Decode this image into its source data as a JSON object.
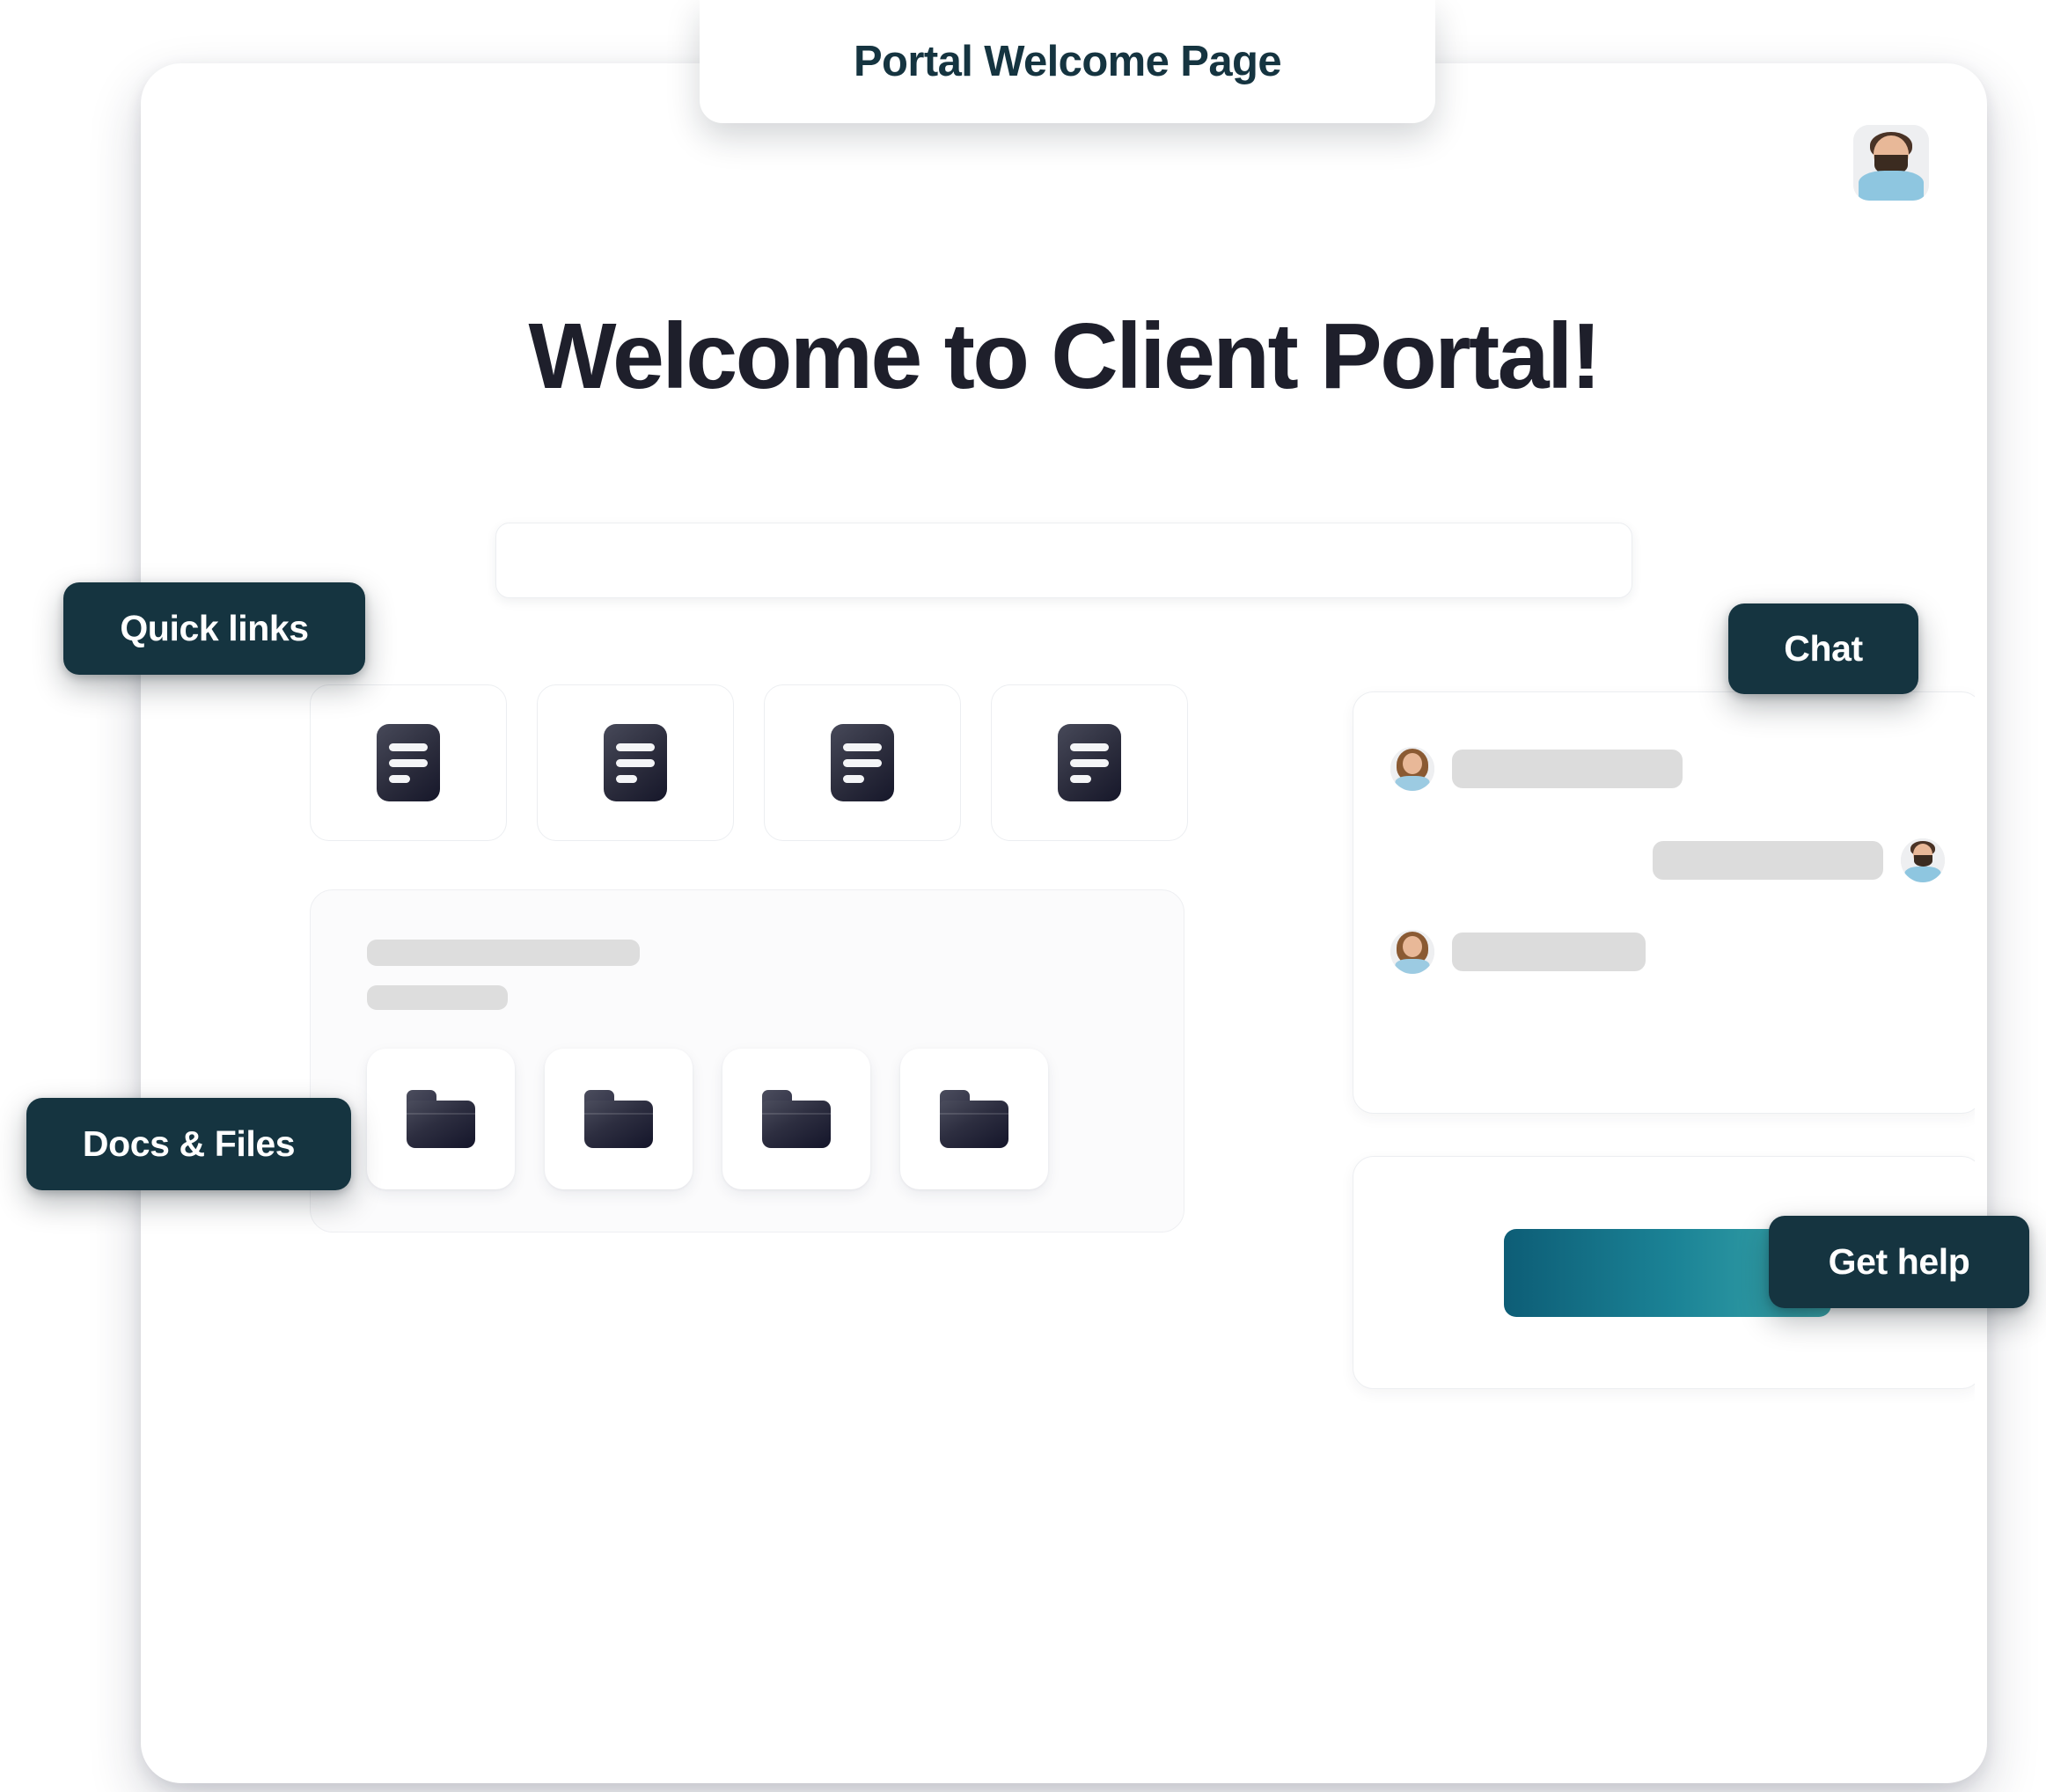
{
  "callouts": {
    "title": "Portal Welcome Page",
    "quick_links": "Quick links",
    "docs_files": "Docs & Files",
    "chat": "Chat",
    "get_help": "Get help"
  },
  "header": {
    "avatar_name": "user-avatar"
  },
  "main": {
    "heading": "Welcome to Client Portal!",
    "search": {
      "value": "",
      "placeholder": ""
    }
  },
  "quick_links": {
    "cards": [
      {
        "icon": "document-icon"
      },
      {
        "icon": "document-icon"
      },
      {
        "icon": "document-icon"
      },
      {
        "icon": "document-icon"
      }
    ]
  },
  "docs_panel": {
    "skeleton_lines": [
      "",
      ""
    ],
    "folders": [
      {
        "icon": "folder-icon"
      },
      {
        "icon": "folder-icon"
      },
      {
        "icon": "folder-icon"
      },
      {
        "icon": "folder-icon"
      }
    ]
  },
  "chat_panel": {
    "messages": [
      {
        "side": "left",
        "avatar": "woman-avatar",
        "bubble_width": 262
      },
      {
        "side": "right",
        "avatar": "man-avatar",
        "bubble_width": 262
      },
      {
        "side": "left",
        "avatar": "woman-avatar",
        "bubble_width": 220
      }
    ]
  },
  "help_panel": {
    "cta_label": ""
  },
  "colors": {
    "chip_bg": "#153440",
    "chip_text": "#ffffff",
    "title_text": "#153440",
    "heading": "#1e1f2b",
    "skeleton": "#dcdcdc",
    "cta_gradient_start": "#0d5d76",
    "cta_gradient_end": "#3aa7ab",
    "icon_dark": "#2b2c3c",
    "card_border": "#eceef1",
    "panel_bg": "#fbfbfc"
  }
}
